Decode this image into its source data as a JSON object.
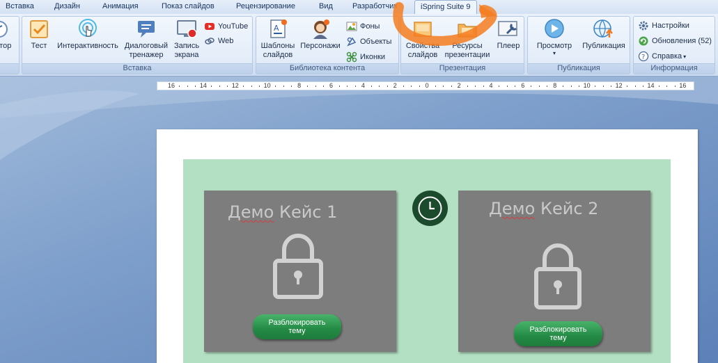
{
  "tabs": [
    {
      "id": "insert",
      "label": "Вставка"
    },
    {
      "id": "design",
      "label": "Дизайн"
    },
    {
      "id": "animation",
      "label": "Анимация"
    },
    {
      "id": "slideshow",
      "label": "Показ слайдов"
    },
    {
      "id": "review",
      "label": "Рецензирование"
    },
    {
      "id": "view",
      "label": "Вид"
    },
    {
      "id": "developer",
      "label": "Разработчик"
    },
    {
      "id": "ispring",
      "label": "iSpring Suite 9",
      "active": true
    }
  ],
  "ribbon": {
    "edge_button": {
      "label": "стор"
    },
    "insert_group": {
      "label": "Вставка",
      "test": "Тест",
      "interactivity": "Интерактивность",
      "dialog": [
        "Диалоговый",
        "тренажер"
      ],
      "screen": [
        "Запись",
        "экрана"
      ],
      "youtube": "YouTube",
      "web": "Web"
    },
    "library_group": {
      "label": "Библиотека контента",
      "templates": [
        "Шаблоны",
        "слайдов"
      ],
      "characters": "Персонажи",
      "backgrounds": "Фоны",
      "objects": "Объекты",
      "icons": "Иконки"
    },
    "presentation_group": {
      "label": "Презентация",
      "slide_props": [
        "Свойства",
        "слайдов"
      ],
      "resources": [
        "Ресурсы",
        "презентации"
      ],
      "player": "Плеер"
    },
    "publish_group": {
      "label": "Публикация",
      "preview": "Просмотр",
      "publish": "Публикация"
    },
    "info_group": {
      "label": "Информация",
      "settings": "Настройки",
      "updates": "Обновления (52)",
      "help": "Справка"
    }
  },
  "ruler": {
    "ticks": [
      "16",
      "14",
      "12",
      "10",
      "8",
      "6",
      "4",
      "2",
      "0",
      "2",
      "4",
      "6",
      "8",
      "10",
      "12",
      "14",
      "16"
    ]
  },
  "slide": {
    "cards": [
      {
        "title_word": "Демо",
        "title_rest": " Кейс 1",
        "button": [
          "Разблокировать",
          "тему"
        ]
      },
      {
        "title_word": "Демо",
        "title_rest": " Кейс 2",
        "button": [
          "Разблокировать",
          "тему"
        ]
      }
    ]
  },
  "colors": {
    "slide_bg": "#b3dfc2",
    "card_bg": "#7d7d7d",
    "button_green": "#2a9a4f",
    "clock_bg": "#1c4a2c",
    "highlight": "#f47c20"
  }
}
